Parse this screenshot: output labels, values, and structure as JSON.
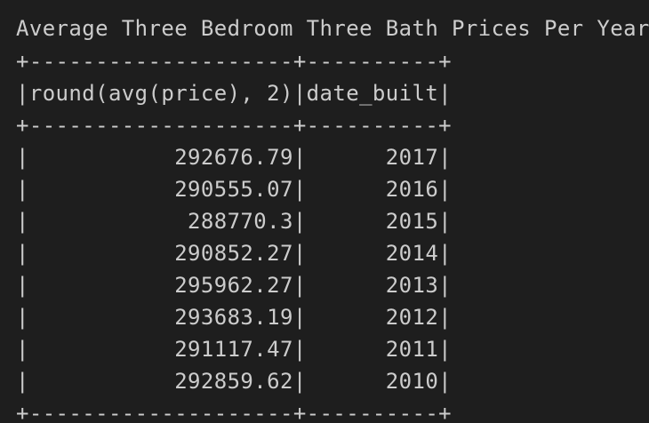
{
  "title": "Average Three Bedroom Three Bath Prices Per Year",
  "table": {
    "border": "+--------------------+----------+",
    "header": "|round(avg(price), 2)|date_built|",
    "rows": [
      "|           292676.79|      2017|",
      "|           290555.07|      2016|",
      "|            288770.3|      2015|",
      "|           290852.27|      2014|",
      "|           295962.27|      2013|",
      "|           293683.19|      2012|",
      "|           291117.47|      2011|",
      "|           292859.62|      2010|"
    ]
  },
  "colors": {
    "background": "#1e1e1e",
    "text": "#cccccc"
  }
}
